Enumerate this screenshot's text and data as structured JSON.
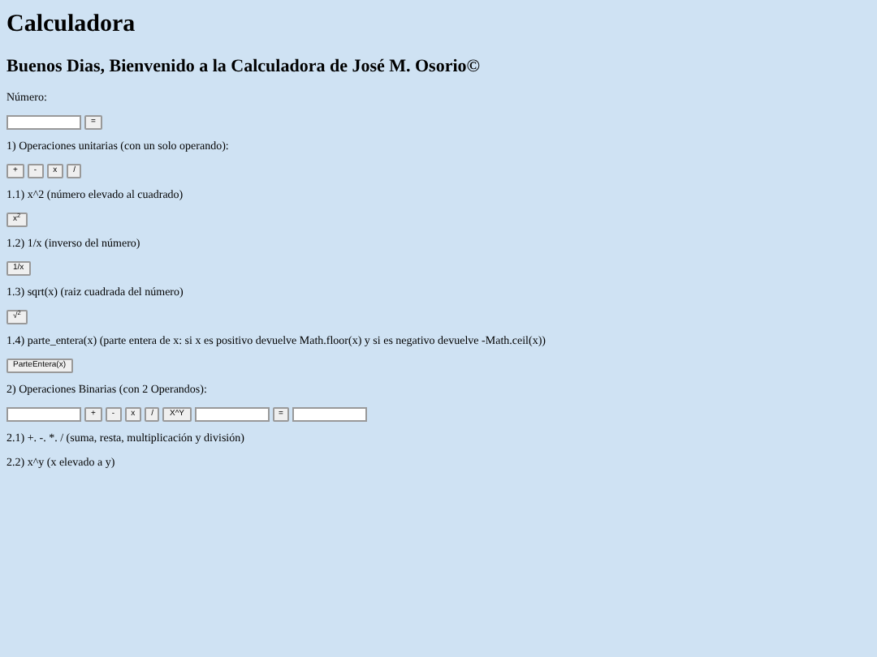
{
  "title": "Calculadora",
  "subtitle": "Buenos Dias, Bienvenido a la Calculadora de José M. Osorio©",
  "blocks": [
    {
      "kind": "text",
      "text": "Número:"
    },
    {
      "kind": "controls",
      "items": [
        {
          "kind": "input"
        },
        {
          "kind": "button",
          "label": "="
        }
      ]
    },
    {
      "kind": "text",
      "text": "1) Operaciones unitarias (con un solo operando):"
    },
    {
      "kind": "controls",
      "items": [
        {
          "kind": "button",
          "label": "+"
        },
        {
          "kind": "button",
          "label": "-"
        },
        {
          "kind": "button",
          "label": "x"
        },
        {
          "kind": "button",
          "label": "/"
        }
      ]
    },
    {
      "kind": "text",
      "text": "1.1) x^2 (número elevado al cuadrado)"
    },
    {
      "kind": "controls",
      "items": [
        {
          "kind": "button",
          "label": "x$^{2}$"
        }
      ]
    },
    {
      "kind": "text",
      "text": "1.2) 1/x (inverso del número)"
    },
    {
      "kind": "controls",
      "items": [
        {
          "kind": "button",
          "label": "1/x"
        }
      ]
    },
    {
      "kind": "text",
      "text": "1.3) sqrt(x) (raiz cuadrada del número)"
    },
    {
      "kind": "controls",
      "items": [
        {
          "kind": "button",
          "label": "√$^{2}$"
        }
      ]
    },
    {
      "kind": "text",
      "text": "1.4) parte_entera(x) (parte entera de x: si x es positivo devuelve Math.floor(x) y si es negativo devuelve -Math.ceil(x))"
    },
    {
      "kind": "controls",
      "items": [
        {
          "kind": "button",
          "label": "ParteEntera(x)"
        }
      ]
    },
    {
      "kind": "text",
      "text": "2) Operaciones Binarias (con 2 Operandos):"
    },
    {
      "kind": "controls",
      "items": [
        {
          "kind": "input"
        },
        {
          "kind": "button",
          "label": "+"
        },
        {
          "kind": "button",
          "label": "-"
        },
        {
          "kind": "button",
          "label": "x"
        },
        {
          "kind": "button",
          "label": "/"
        },
        {
          "kind": "button",
          "label": "X^Y"
        },
        {
          "kind": "input"
        },
        {
          "kind": "button",
          "label": "="
        },
        {
          "kind": "input"
        }
      ]
    },
    {
      "kind": "text",
      "text": "2.1) +. -. *. / (suma, resta, multiplicación y división)"
    },
    {
      "kind": "text",
      "text": "2.2) x^y (x elevado a y)"
    }
  ]
}
